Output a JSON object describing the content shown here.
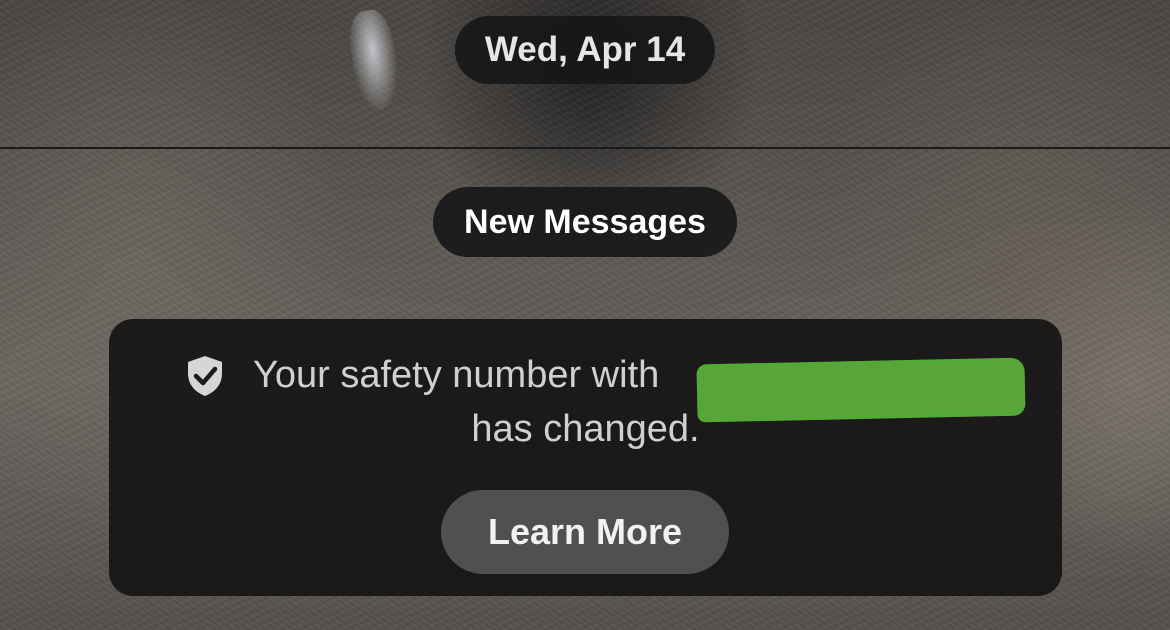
{
  "date_pill": {
    "label": "Wed, Apr 14"
  },
  "new_messages_pill": {
    "label": "New Messages"
  },
  "safety_notice": {
    "text_line1": "Your safety number with",
    "text_line2": "has changed.",
    "icon": "shield-check-icon",
    "redaction_color": "#5aa53a",
    "learn_more_label": "Learn More"
  }
}
